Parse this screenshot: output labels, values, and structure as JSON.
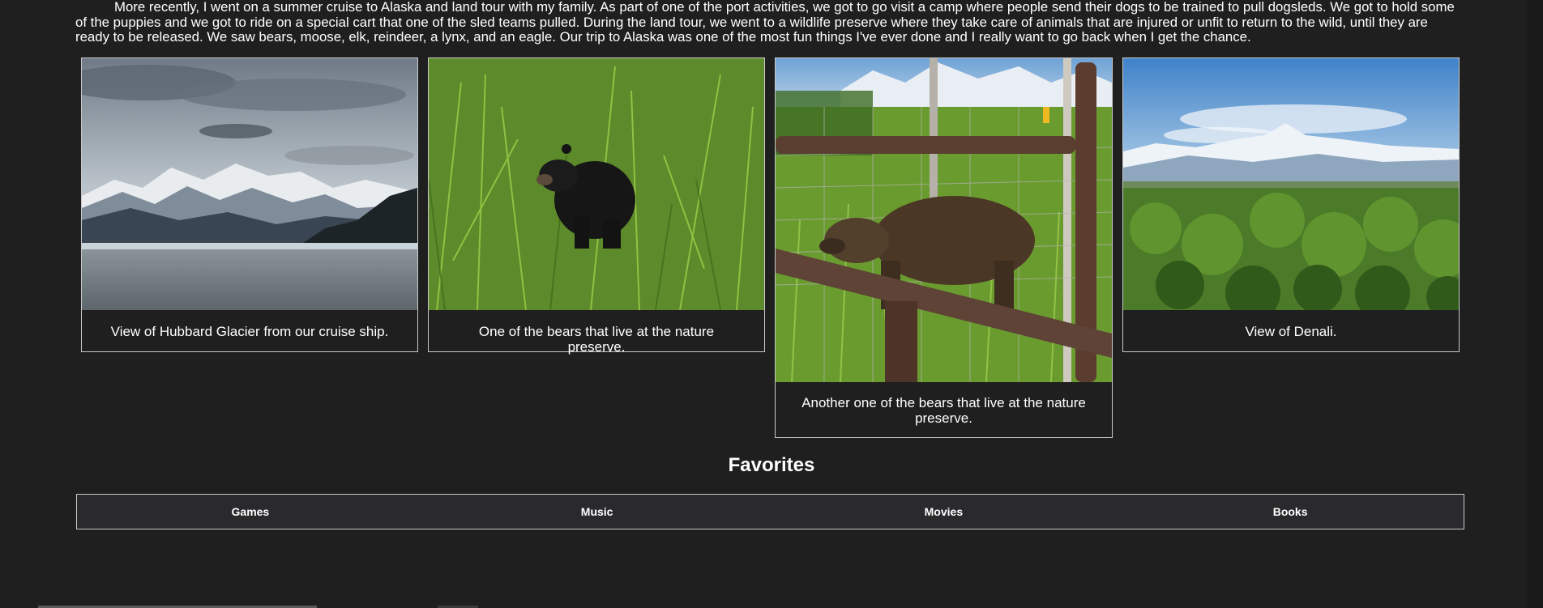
{
  "intro": {
    "text": "More recently, I went on a summer cruise to Alaska and land tour with my family. As part of one of the port activities, we got to go visit a camp where people send their dogs to be trained to pull dogsleds. We got to hold some of the puppies and we got to ride on a special cart that one of the sled teams pulled. During the land tour, we went to a wildlife preserve where they take care of animals that are injured or unfit to return to the wild, until they are ready to be released. We saw bears, moose, elk, reindeer, a lynx, and an eagle. Our trip to Alaska was one of the most fun things I've ever done and I really want to go back when I get the chance."
  },
  "gallery": [
    {
      "caption": "View of Hubbard Glacier from our cruise ship.",
      "image": "glacier-photo"
    },
    {
      "caption": "One of the bears that live at the nature preserve.",
      "image": "black-bear-photo"
    },
    {
      "caption": "Another one of the bears that live at the nature preserve.",
      "image": "brown-bear-photo"
    },
    {
      "caption": "View of Denali.",
      "image": "denali-photo"
    }
  ],
  "favorites": {
    "title": "Favorites",
    "links": [
      "Games",
      "Music",
      "Movies",
      "Books"
    ]
  },
  "colors": {
    "background": "#1f1f1f",
    "text": "#ffffff",
    "border": "#c9c9c9",
    "nav_background": "#2a2a2d"
  }
}
